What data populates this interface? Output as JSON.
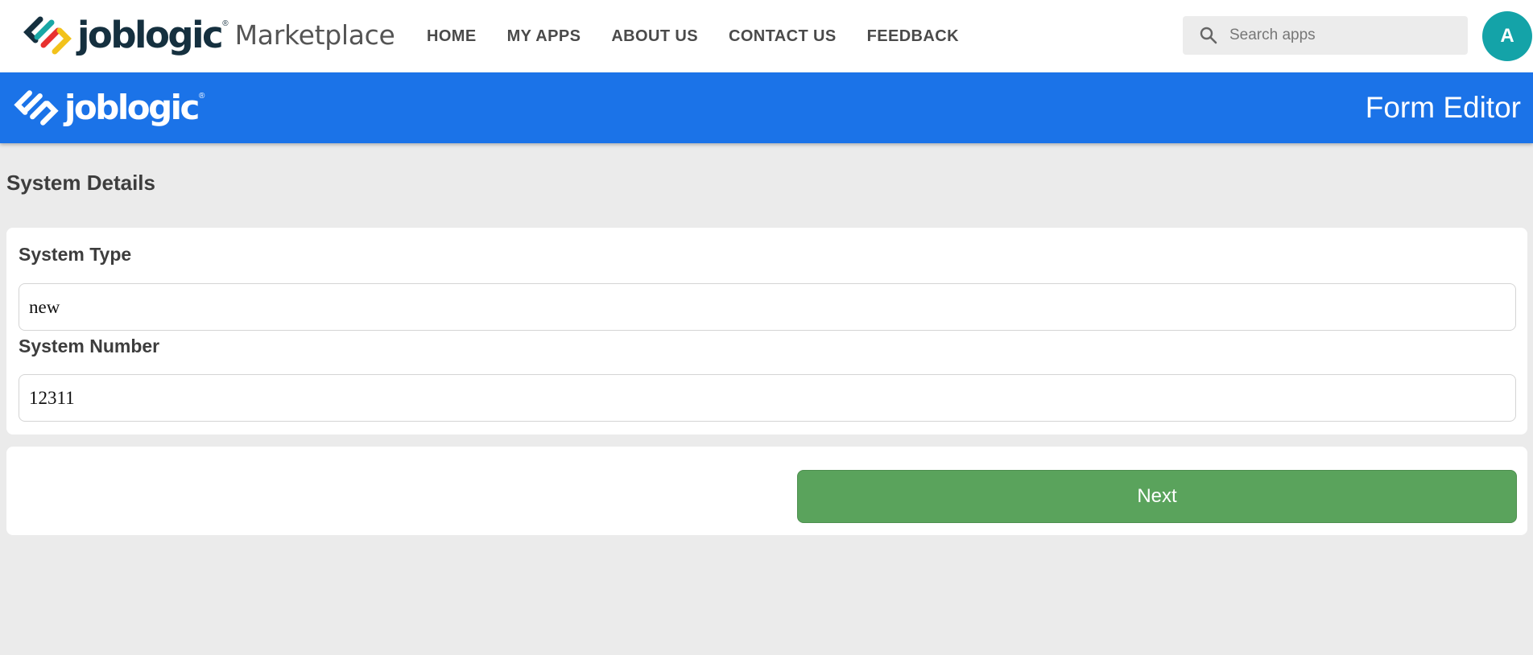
{
  "topbar": {
    "brand_word": "joblogic",
    "brand_reg": "®",
    "brand_sub": "Marketplace",
    "nav": [
      "HOME",
      "MY APPS",
      "ABOUT US",
      "CONTACT US",
      "FEEDBACK"
    ],
    "search_placeholder": "Search apps",
    "avatar_initial": "A",
    "colors": {
      "avatar": "#14a3a8",
      "brand_text": "#15303f"
    }
  },
  "appbar": {
    "brand_word": "joblogic",
    "brand_reg": "®",
    "title": "Form Editor",
    "color": "#1b73e8"
  },
  "form": {
    "section_title": "System Details",
    "fields": [
      {
        "label": "System Type",
        "value": "new"
      },
      {
        "label": "System Number",
        "value": "12311"
      }
    ],
    "next_label": "Next",
    "next_color": "#5aa35c"
  }
}
